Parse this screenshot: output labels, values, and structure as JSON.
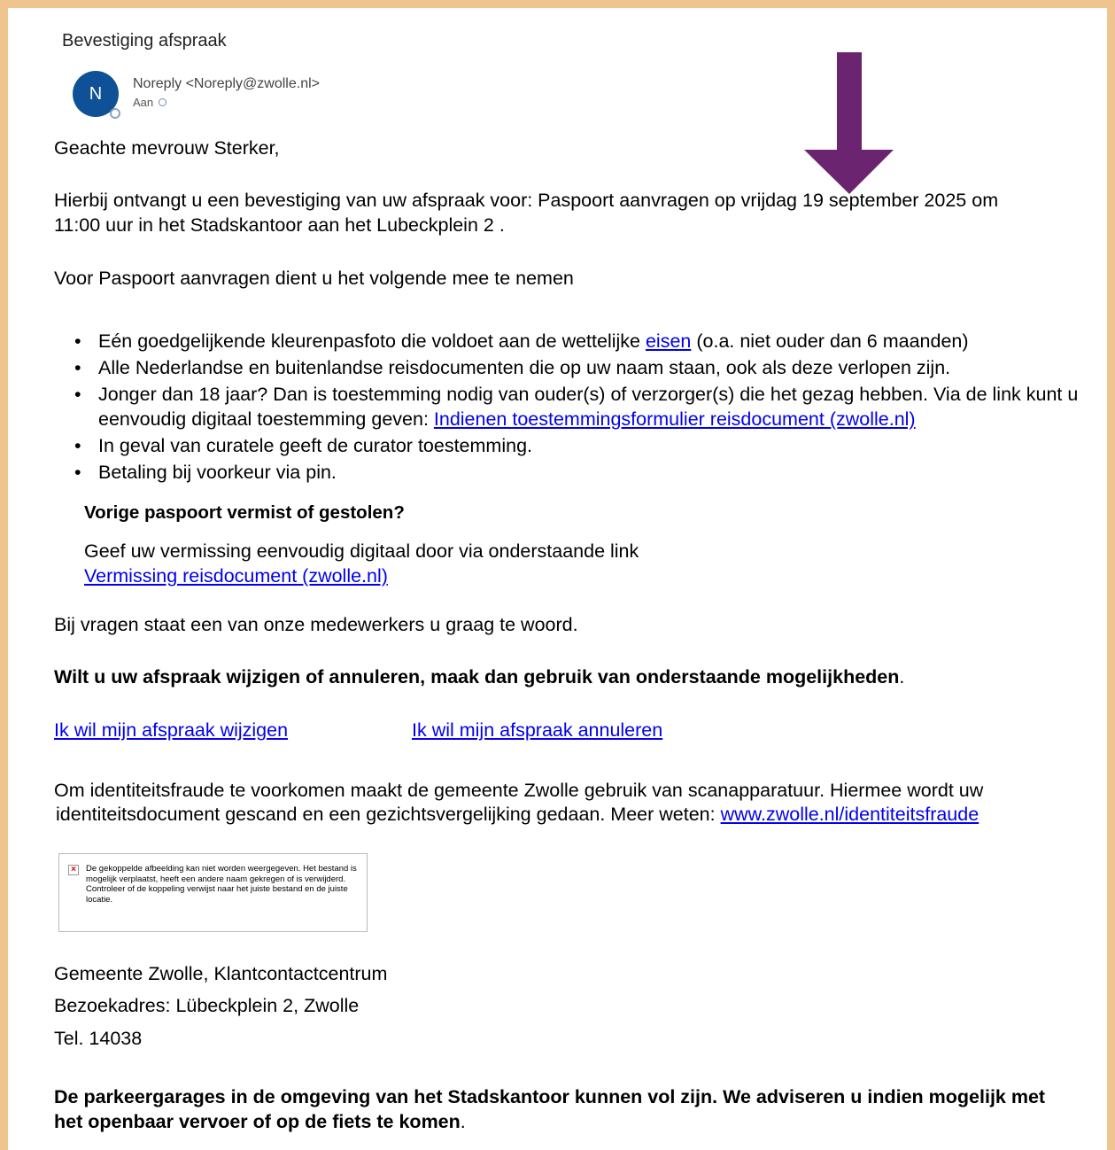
{
  "email": {
    "subject": "Bevestiging afspraak",
    "avatar_initial": "N",
    "sender": "Noreply <Noreply@zwolle.nl>",
    "to_label": "Aan"
  },
  "body": {
    "greeting": "Geachte mevrouw Sterker,",
    "confirmation_line1": "Hierbij ontvangt u een bevestiging van uw afspraak voor: Paspoort aanvragen op vrijdag 19 september 2025 om",
    "confirmation_line2": "11:00 uur in het Stadskantoor aan het Lubeckplein 2 .",
    "bring_intro": "Voor Paspoort aanvragen dient u het volgende mee te nemen",
    "req1_pre": "Eén goedgelijkende kleurenpasfoto die voldoet aan de wettelijke ",
    "req1_link": "eisen",
    "req1_post": " (o.a. niet ouder dan 6 maanden)",
    "req2": "Alle Nederlandse en buitenlandse reisdocumenten die op uw naam staan, ook als deze verlopen zijn.",
    "req3_pre": "Jonger dan 18 jaar? Dan is toestemming nodig van ouder(s) of verzorger(s) die het gezag hebben. Via de link kunt u eenvoudig digitaal toestemming geven: ",
    "req3_link": "Indienen toestemmingsformulier reisdocument (zwolle.nl)",
    "req4": "In geval van curatele geeft de curator toestemming.",
    "req5": "Betaling bij voorkeur via pin.",
    "lost_heading": "Vorige paspoort vermist of gestolen?",
    "lost_text": "Geef uw vermissing eenvoudig digitaal door via onderstaande link",
    "lost_link": "Vermissing reisdocument (zwolle.nl)",
    "questions": "Bij vragen staat een van onze medewerkers u graag te woord.",
    "change_heading": "Wilt u uw afspraak wijzigen of annuleren, maak dan gebruik van onderstaande mogelijkheden",
    "change_heading_dot": ".",
    "change_link": "Ik wil mijn afspraak wijzigen",
    "cancel_link": "Ik wil mijn afspraak annuleren",
    "fraud_line1": "Om identiteitsfraude te voorkomen maakt de gemeente Zwolle gebruik van scanapparatuur. Hiermee wordt uw",
    "fraud_line2_pre": "identiteitsdocument gescand en een gezichtsvergelijking gedaan. Meer weten: ",
    "fraud_link": "www.zwolle.nl/identiteitsfraude",
    "broken_image_text": "De gekoppelde afbeelding kan niet worden weergegeven. Het bestand is mogelijk verplaatst, heeft een andere naam gekregen of is verwijderd. Controleer of de koppeling verwijst naar het juiste bestand en de juiste locatie.",
    "sig_line1": "Gemeente Zwolle, Klantcontactcentrum",
    "sig_line2": "Bezoekadres: Lübeckplein 2, Zwolle",
    "sig_line3": "Tel. 14038",
    "parking": "De parkeergarages in de omgeving van het Stadskantoor kunnen vol zijn. We adviseren u indien mogelijk met het openbaar vervoer of op de fiets te komen",
    "parking_dot": "."
  },
  "colors": {
    "frame": "#efc48e",
    "avatar": "#0f5196",
    "arrow": "#6b2470",
    "link": "#0000ee"
  }
}
